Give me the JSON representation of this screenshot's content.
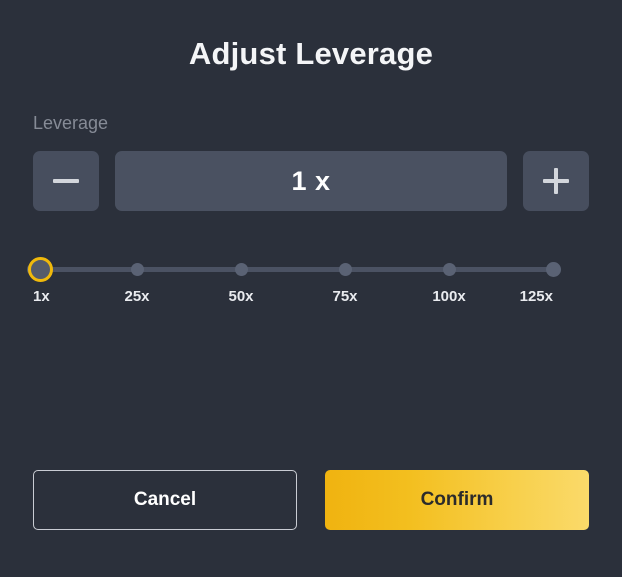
{
  "dialog": {
    "title": "Adjust Leverage",
    "field_label": "Leverage"
  },
  "stepper": {
    "decrease_icon": "minus-icon",
    "increase_icon": "plus-icon",
    "value": "1 x",
    "placeholder": "1 x"
  },
  "slider": {
    "current_value": 1,
    "min": 1,
    "max": 125,
    "ticks": [
      {
        "label": "1x",
        "value": 1,
        "percent": 0
      },
      {
        "label": "25x",
        "value": 25,
        "percent": 20
      },
      {
        "label": "50x",
        "value": 50,
        "percent": 40
      },
      {
        "label": "75x",
        "value": 75,
        "percent": 60
      },
      {
        "label": "100x",
        "value": 100,
        "percent": 80
      },
      {
        "label": "125x",
        "value": 125,
        "percent": 100
      }
    ]
  },
  "footer": {
    "cancel_label": "Cancel",
    "confirm_label": "Confirm"
  },
  "colors": {
    "background": "#2b303b",
    "input_fill": "#4a5161",
    "button_fill": "#474e5e",
    "accent": "#f0b90b",
    "confirm_gradient_start": "#f0b310",
    "confirm_gradient_end": "#fada6a",
    "label_text": "#868b96",
    "track": "#4b5263",
    "tick_dot": "#5a6274"
  }
}
